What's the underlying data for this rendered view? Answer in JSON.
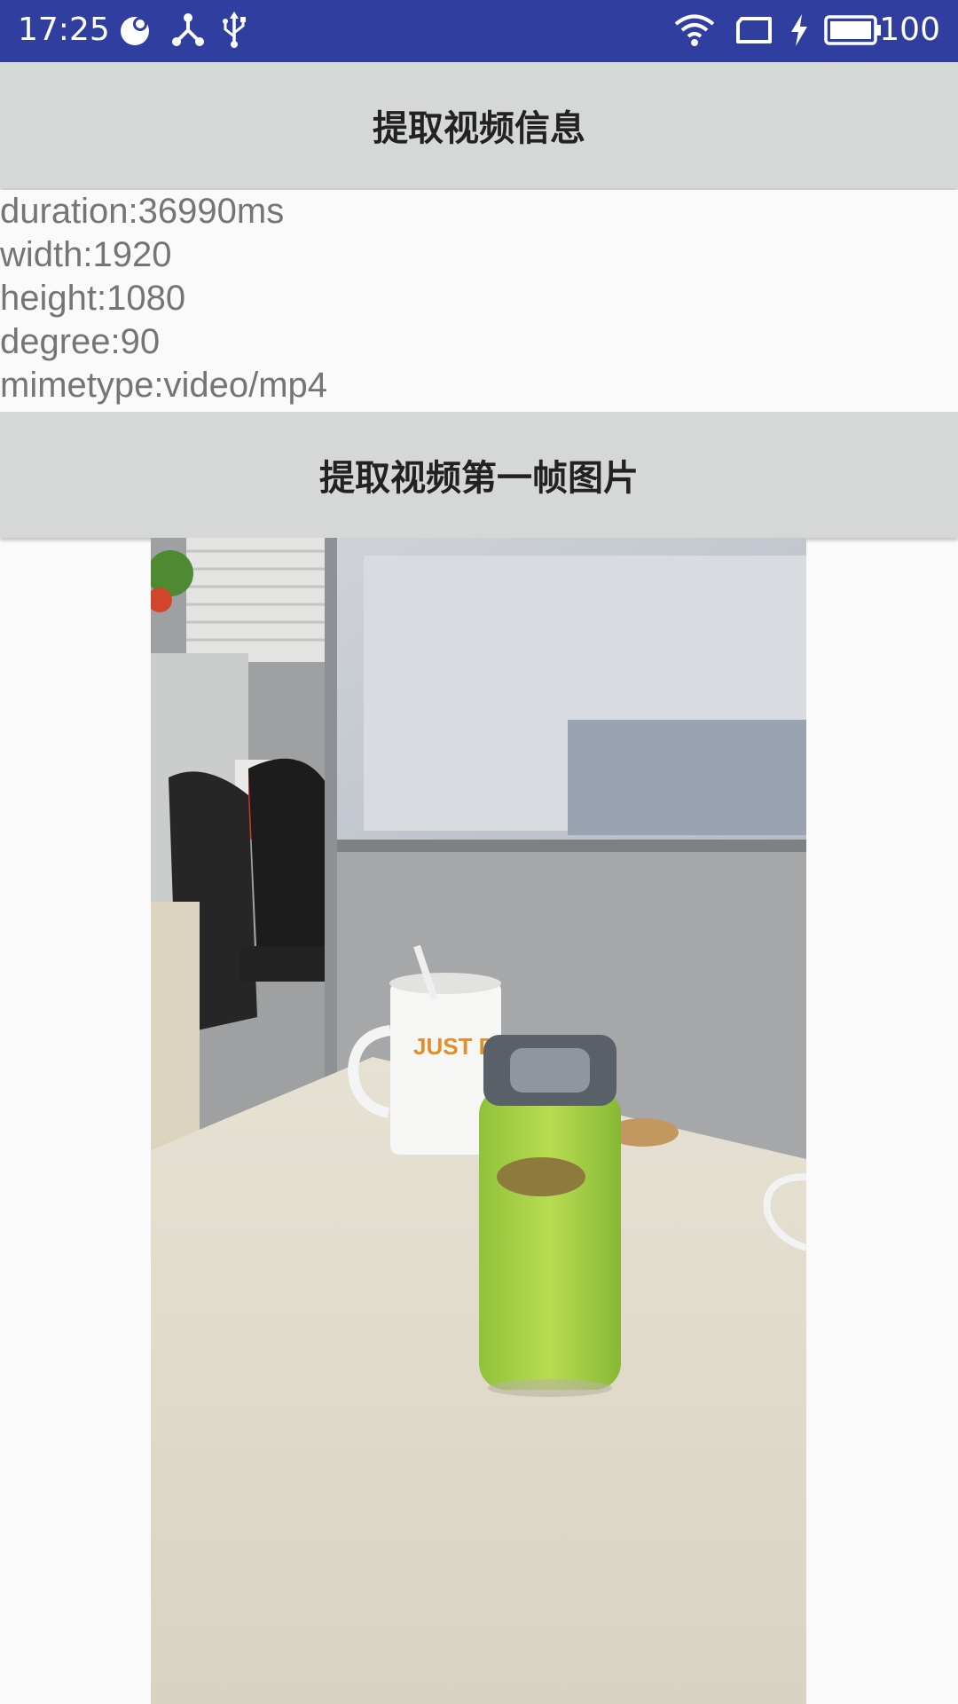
{
  "status_bar": {
    "time": "17:25",
    "battery_percent": "100",
    "icons": [
      "notification-bubble-icon",
      "share-icon",
      "usb-icon",
      "wifi-icon",
      "screen-rotate-icon",
      "charging-bolt-icon",
      "battery-icon"
    ]
  },
  "buttons": {
    "extract_info": "提取视频信息",
    "extract_frame": "提取视频第一帧图片"
  },
  "info": {
    "lines": [
      "duration:36990ms",
      "width:1920",
      "height:1080",
      "degree:90",
      "mimetype:video/mp4"
    ]
  },
  "frame_image": {
    "mug_text": "JUST DO GIT"
  },
  "colors": {
    "status_bar": "#303f9f",
    "button_bg": "#d6d7d7",
    "background": "#fafafa",
    "info_text": "#757575"
  }
}
